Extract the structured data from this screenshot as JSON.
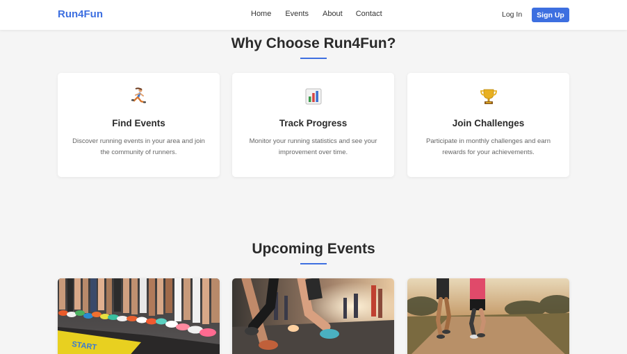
{
  "nav": {
    "logo": "Run4Fun",
    "links": [
      "Home",
      "Events",
      "About",
      "Contact"
    ],
    "login": "Log In",
    "signup": "Sign Up"
  },
  "features": {
    "title": "Why Choose Run4Fun?",
    "cards": [
      {
        "icon": "runner-icon",
        "title": "Find Events",
        "description": "Discover running events in your area and join the community of runners."
      },
      {
        "icon": "bar-chart-icon",
        "title": "Track Progress",
        "description": "Monitor your running statistics and see your improvement over time."
      },
      {
        "icon": "trophy-icon",
        "title": "Join Challenges",
        "description": "Participate in monthly challenges and earn rewards for your achievements."
      }
    ]
  },
  "events": {
    "title": "Upcoming Events",
    "images": [
      "marathon-start-line-image",
      "city-road-race-image",
      "trail-run-image"
    ]
  },
  "colors": {
    "accent": "#3d6fe0",
    "background": "#f5f5f5",
    "card": "#ffffff"
  }
}
